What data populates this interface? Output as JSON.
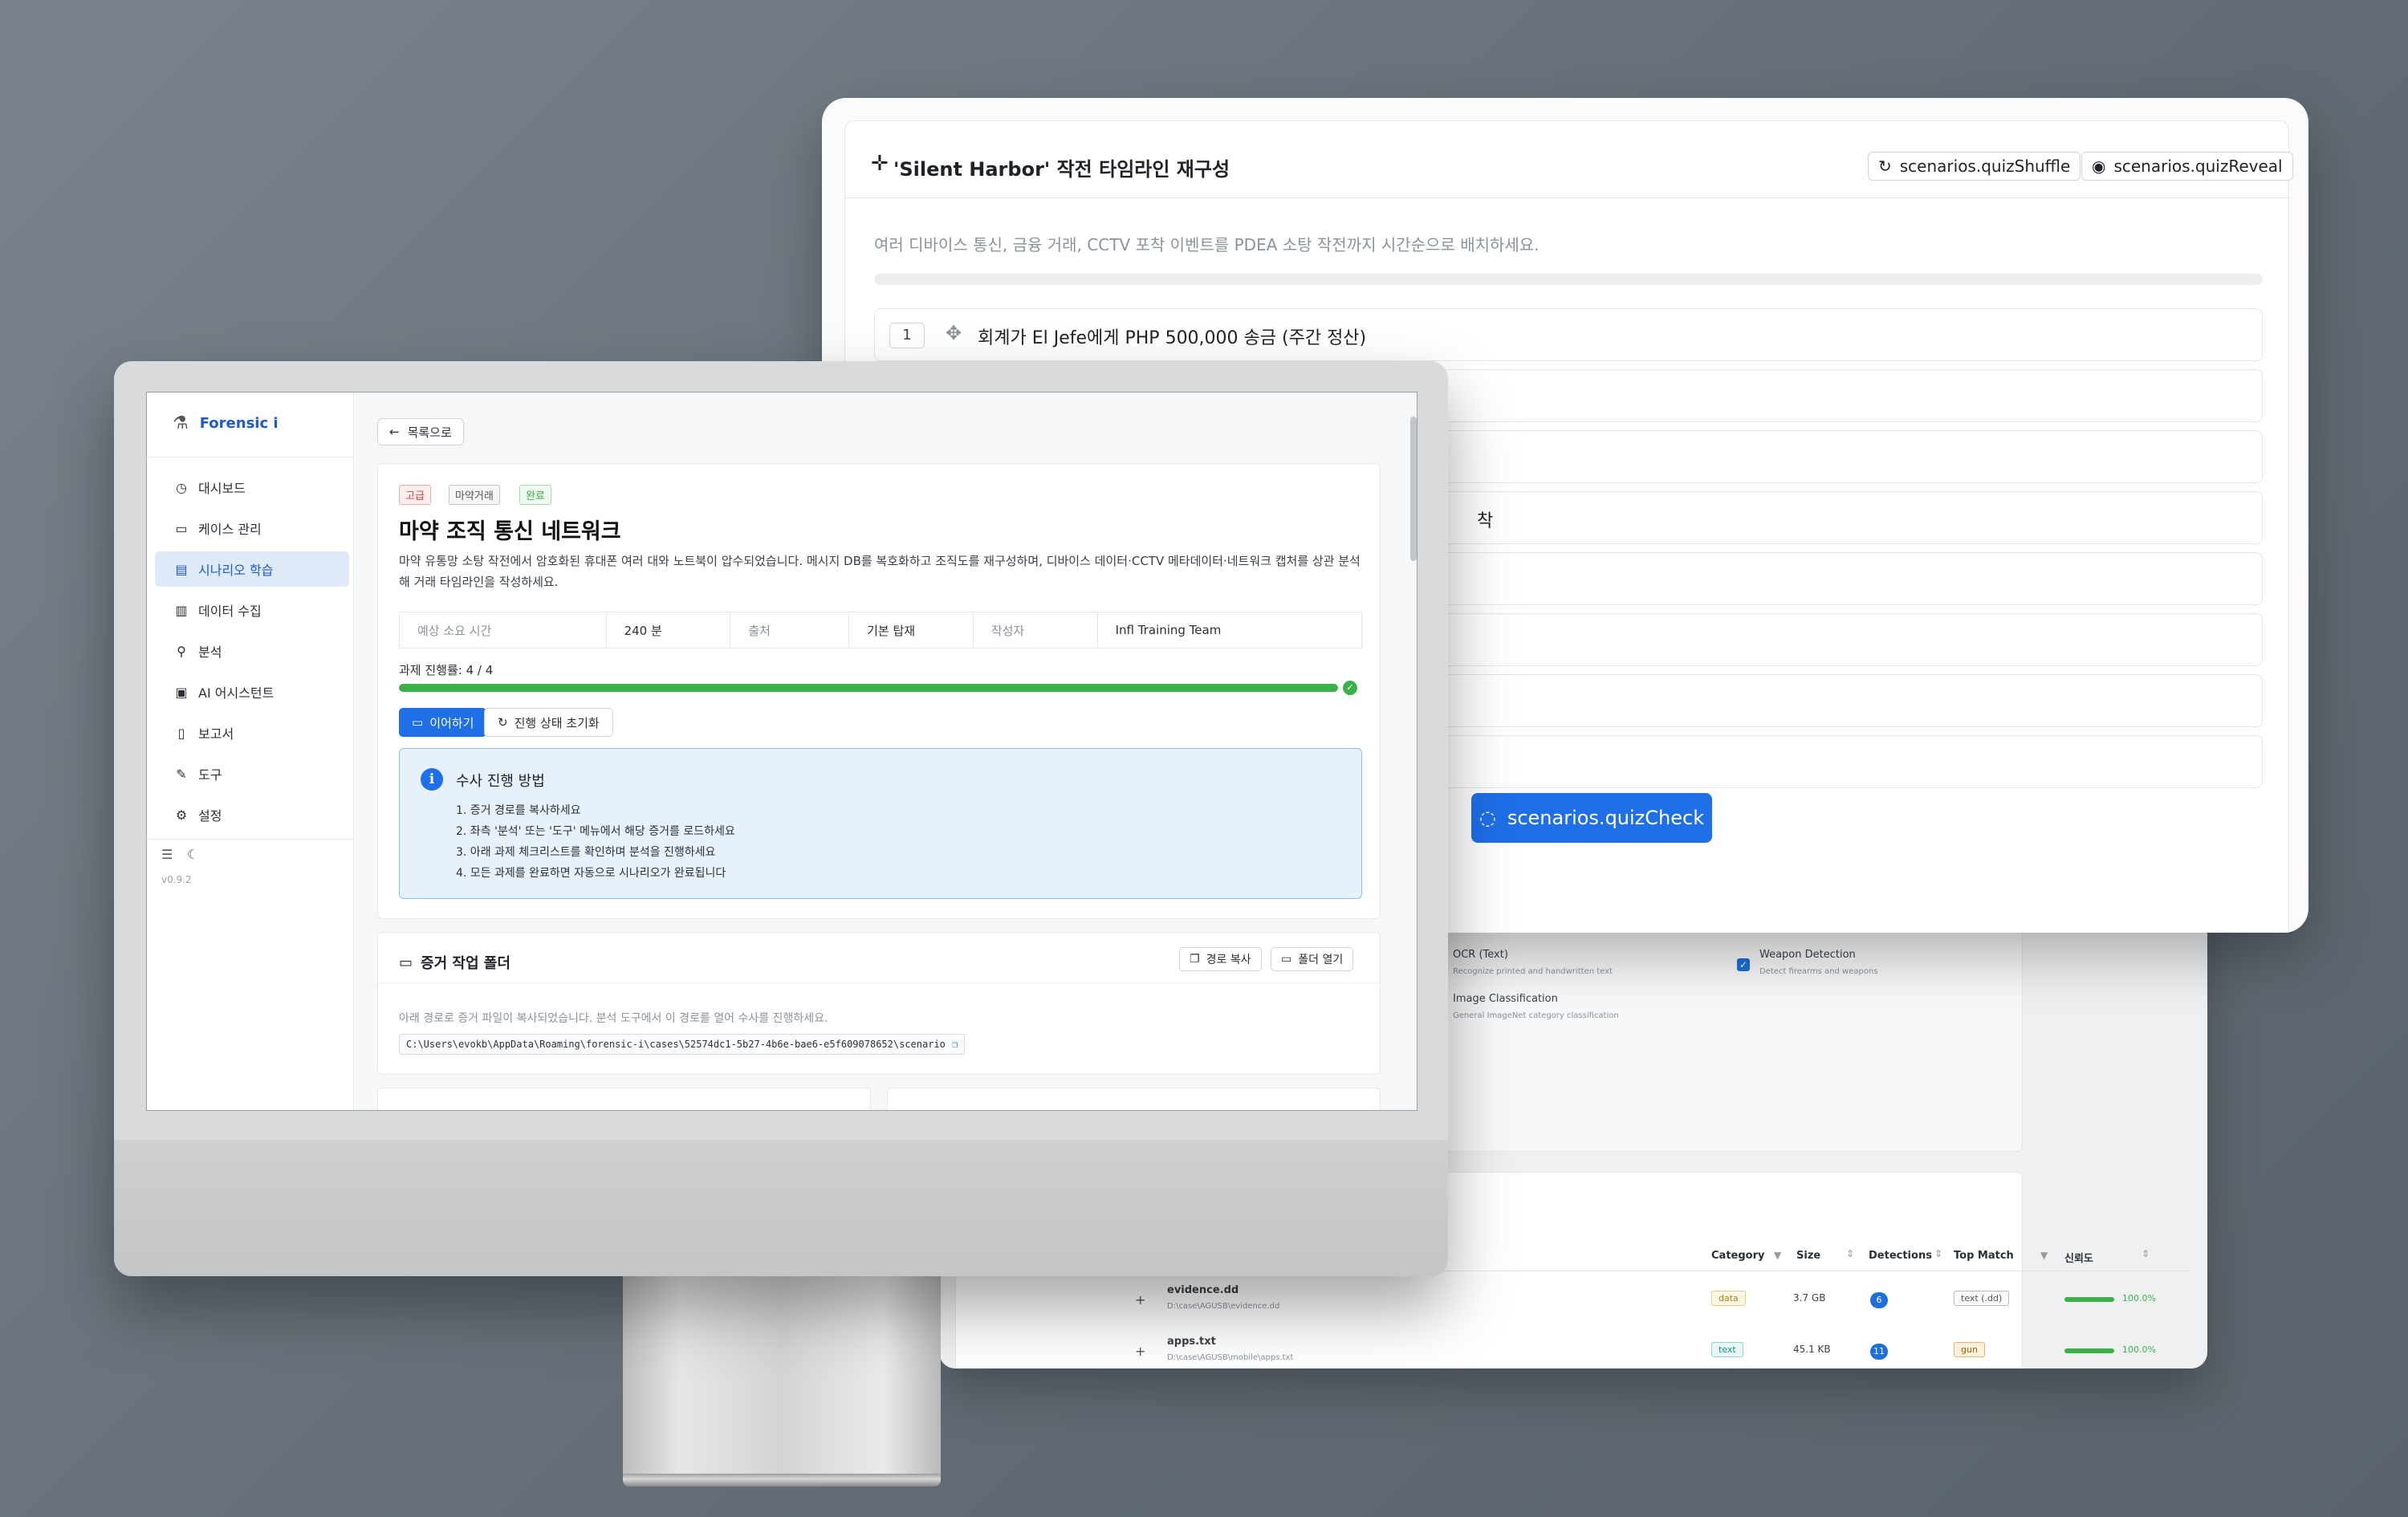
{
  "analysis_window": {
    "options": [
      {
        "label": "OCR (Text)",
        "desc": "Recognize printed and handwritten text",
        "checked": false
      },
      {
        "label": "Image Classification",
        "desc": "General ImageNet category classification",
        "checked": false
      },
      {
        "label": "Weapon Detection",
        "desc": "Detect firearms and weapons",
        "checked": true
      }
    ],
    "table": {
      "headers": [
        "Category",
        "Size",
        "Detections",
        "Top Match",
        "신뢰도"
      ],
      "rows": [
        {
          "expand": "+",
          "name": "evidence.dd",
          "path": "D:\\case\\AGUSB\\evidence.dd",
          "category": "data",
          "size": "3.7 GB",
          "detections": "6",
          "top_match": "text (.dd)",
          "confidence": "100.0%"
        },
        {
          "expand": "+",
          "name": "apps.txt",
          "path": "D:\\case\\AGUSB\\mobile\\apps.txt",
          "category": "text",
          "size": "45.1 KB",
          "detections": "11",
          "top_match": "gun",
          "confidence": "100.0%"
        }
      ]
    }
  },
  "quiz_window": {
    "title": "'Silent Harbor' 작전 타임라인 재구성",
    "shuffle_label": "scenarios.quizShuffle",
    "reveal_label": "scenarios.quizReveal",
    "description": "여러 디바이스 통신, 금융 거래, CCTV 포착 이벤트를 PDEA 소탕 작전까지 시간순으로 배치하세요.",
    "slots": [
      {
        "num": "1",
        "text": "회계가 El Jefe에게 PHP 500,000 송금 (주간 정산)"
      },
      {
        "num": "",
        "text": ""
      },
      {
        "num": "",
        "text": ""
      },
      {
        "num": "",
        "text": "착"
      },
      {
        "num": "",
        "text": ""
      },
      {
        "num": "",
        "text": ""
      },
      {
        "num": "",
        "text": ""
      },
      {
        "num": "",
        "text": ""
      }
    ],
    "check_label": "scenarios.quizCheck"
  },
  "app": {
    "logo": "Forensic i",
    "version": "v0.9.2",
    "sidebar": [
      {
        "icon": "dashboard-icon",
        "glyph": "◷",
        "label": "대시보드",
        "active": false
      },
      {
        "icon": "folder-icon",
        "glyph": "▭",
        "label": "케이스 관리",
        "active": false
      },
      {
        "icon": "book-icon",
        "glyph": "▤",
        "label": "시나리오 학습",
        "active": true
      },
      {
        "icon": "database-icon",
        "glyph": "▥",
        "label": "데이터 수집",
        "active": false
      },
      {
        "icon": "search-icon",
        "glyph": "⚲",
        "label": "분석",
        "active": false
      },
      {
        "icon": "bot-icon",
        "glyph": "▣",
        "label": "AI 어시스턴트",
        "active": false
      },
      {
        "icon": "report-icon",
        "glyph": "▯",
        "label": "보고서",
        "active": false
      },
      {
        "icon": "wrench-icon",
        "glyph": "✎",
        "label": "도구",
        "active": false
      },
      {
        "icon": "gear-icon",
        "glyph": "⚙",
        "label": "설정",
        "active": false
      }
    ],
    "back_label": "목록으로",
    "scenario": {
      "tags": [
        {
          "label": "고급",
          "color": "#d64545"
        },
        {
          "label": "마약거래",
          "color": "#555555"
        },
        {
          "label": "완료",
          "color": "#3bb14a"
        }
      ],
      "title": "마약 조직 통신 네트워크",
      "description": "마약 유통망 소탕 작전에서 암호화된 휴대폰 여러 대와 노트북이 압수되었습니다. 메시지 DB를 복호화하고 조직도를 재구성하며, 디바이스 데이터·CCTV 메타데이터·네트워크 캡처를 상관 분석해 거래 타임라인을 작성하세요.",
      "meta": [
        {
          "key": "예상 소요 시간",
          "value": "240 분"
        },
        {
          "key": "출처",
          "value": "기본 탑재"
        },
        {
          "key": "작성자",
          "value": "Infl Training Team"
        }
      ],
      "progress_label": "과제 진행률: 4 / 4",
      "progress_fraction": 1.0,
      "continue_label": "이어하기",
      "reset_label": "진행 상태 초기화"
    },
    "guide": {
      "title": "수사 진행 방법",
      "steps": [
        "1. 증거 경로를 복사하세요",
        "2. 좌측 '분석' 또는 '도구' 메뉴에서 해당 증거를 로드하세요",
        "3. 아래 과제 체크리스트를 확인하며 분석을 진행하세요",
        "4. 모든 과제를 완료하면 자동으로 시나리오가 완료됩니다"
      ]
    },
    "evidence": {
      "title": "증거 작업 폴더",
      "copy_label": "경로 복사",
      "open_label": "폴더 열기",
      "hint": "아래 경로로 증거 파일이 복사되었습니다. 분석 도구에서 이 경로를 열어 수사를 진행하세요.",
      "path": "C:\\Users\\evokb\\AppData\\Roaming\\forensic-i\\cases\\52574dc1-5b27-4b6e-bae6-e5f609078652\\scenario"
    }
  }
}
